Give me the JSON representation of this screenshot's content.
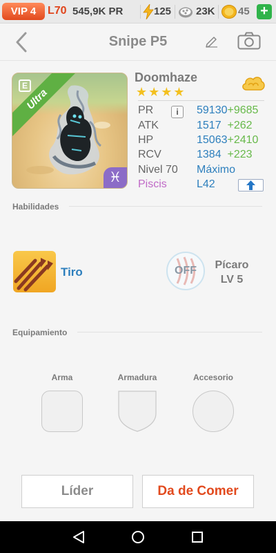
{
  "status_bar": {
    "vip": "VIP 4",
    "level": "L70",
    "power": "545,9K PR",
    "energy": "125",
    "food": "23K",
    "gold": "45",
    "add_label": "+"
  },
  "header": {
    "title": "Snipe P5",
    "back_icon": "chevron-left-icon",
    "edit_icon": "pencil-icon",
    "camera_icon": "camera-icon"
  },
  "monster": {
    "name": "Doomhaze",
    "stars": "★★★★",
    "rarity": "Ultra",
    "badge_letter": "E",
    "element_symbol": "♓",
    "stats": [
      {
        "label": "PR",
        "value": "59130",
        "bonus": "+9685"
      },
      {
        "label": "ATK",
        "value": "1517",
        "bonus": "+262"
      },
      {
        "label": "HP",
        "value": "15063",
        "bonus": "+2410"
      },
      {
        "label": "RCV",
        "value": "1384",
        "bonus": "+223"
      }
    ],
    "level_label": "Nivel 70",
    "level_value": "Máximo",
    "sign_label": "Piscis",
    "sign_value": "L42",
    "info_label": "i"
  },
  "skills": {
    "section_title": "Habilidades",
    "skill_name": "Tiro",
    "leader_state": "OFF",
    "leader_name": "Pícaro",
    "leader_level": "LV 5"
  },
  "equipment": {
    "section_title": "Equipamiento",
    "slots": [
      "Arma",
      "Armadura",
      "Accesorio"
    ]
  },
  "buttons": {
    "leader": "Líder",
    "feed": "Da de Comer"
  },
  "colors": {
    "accent_orange": "#e24a1e",
    "stat_blue": "#2d7fbd",
    "bonus_green": "#67b94a",
    "purple": "#c06ac7"
  }
}
